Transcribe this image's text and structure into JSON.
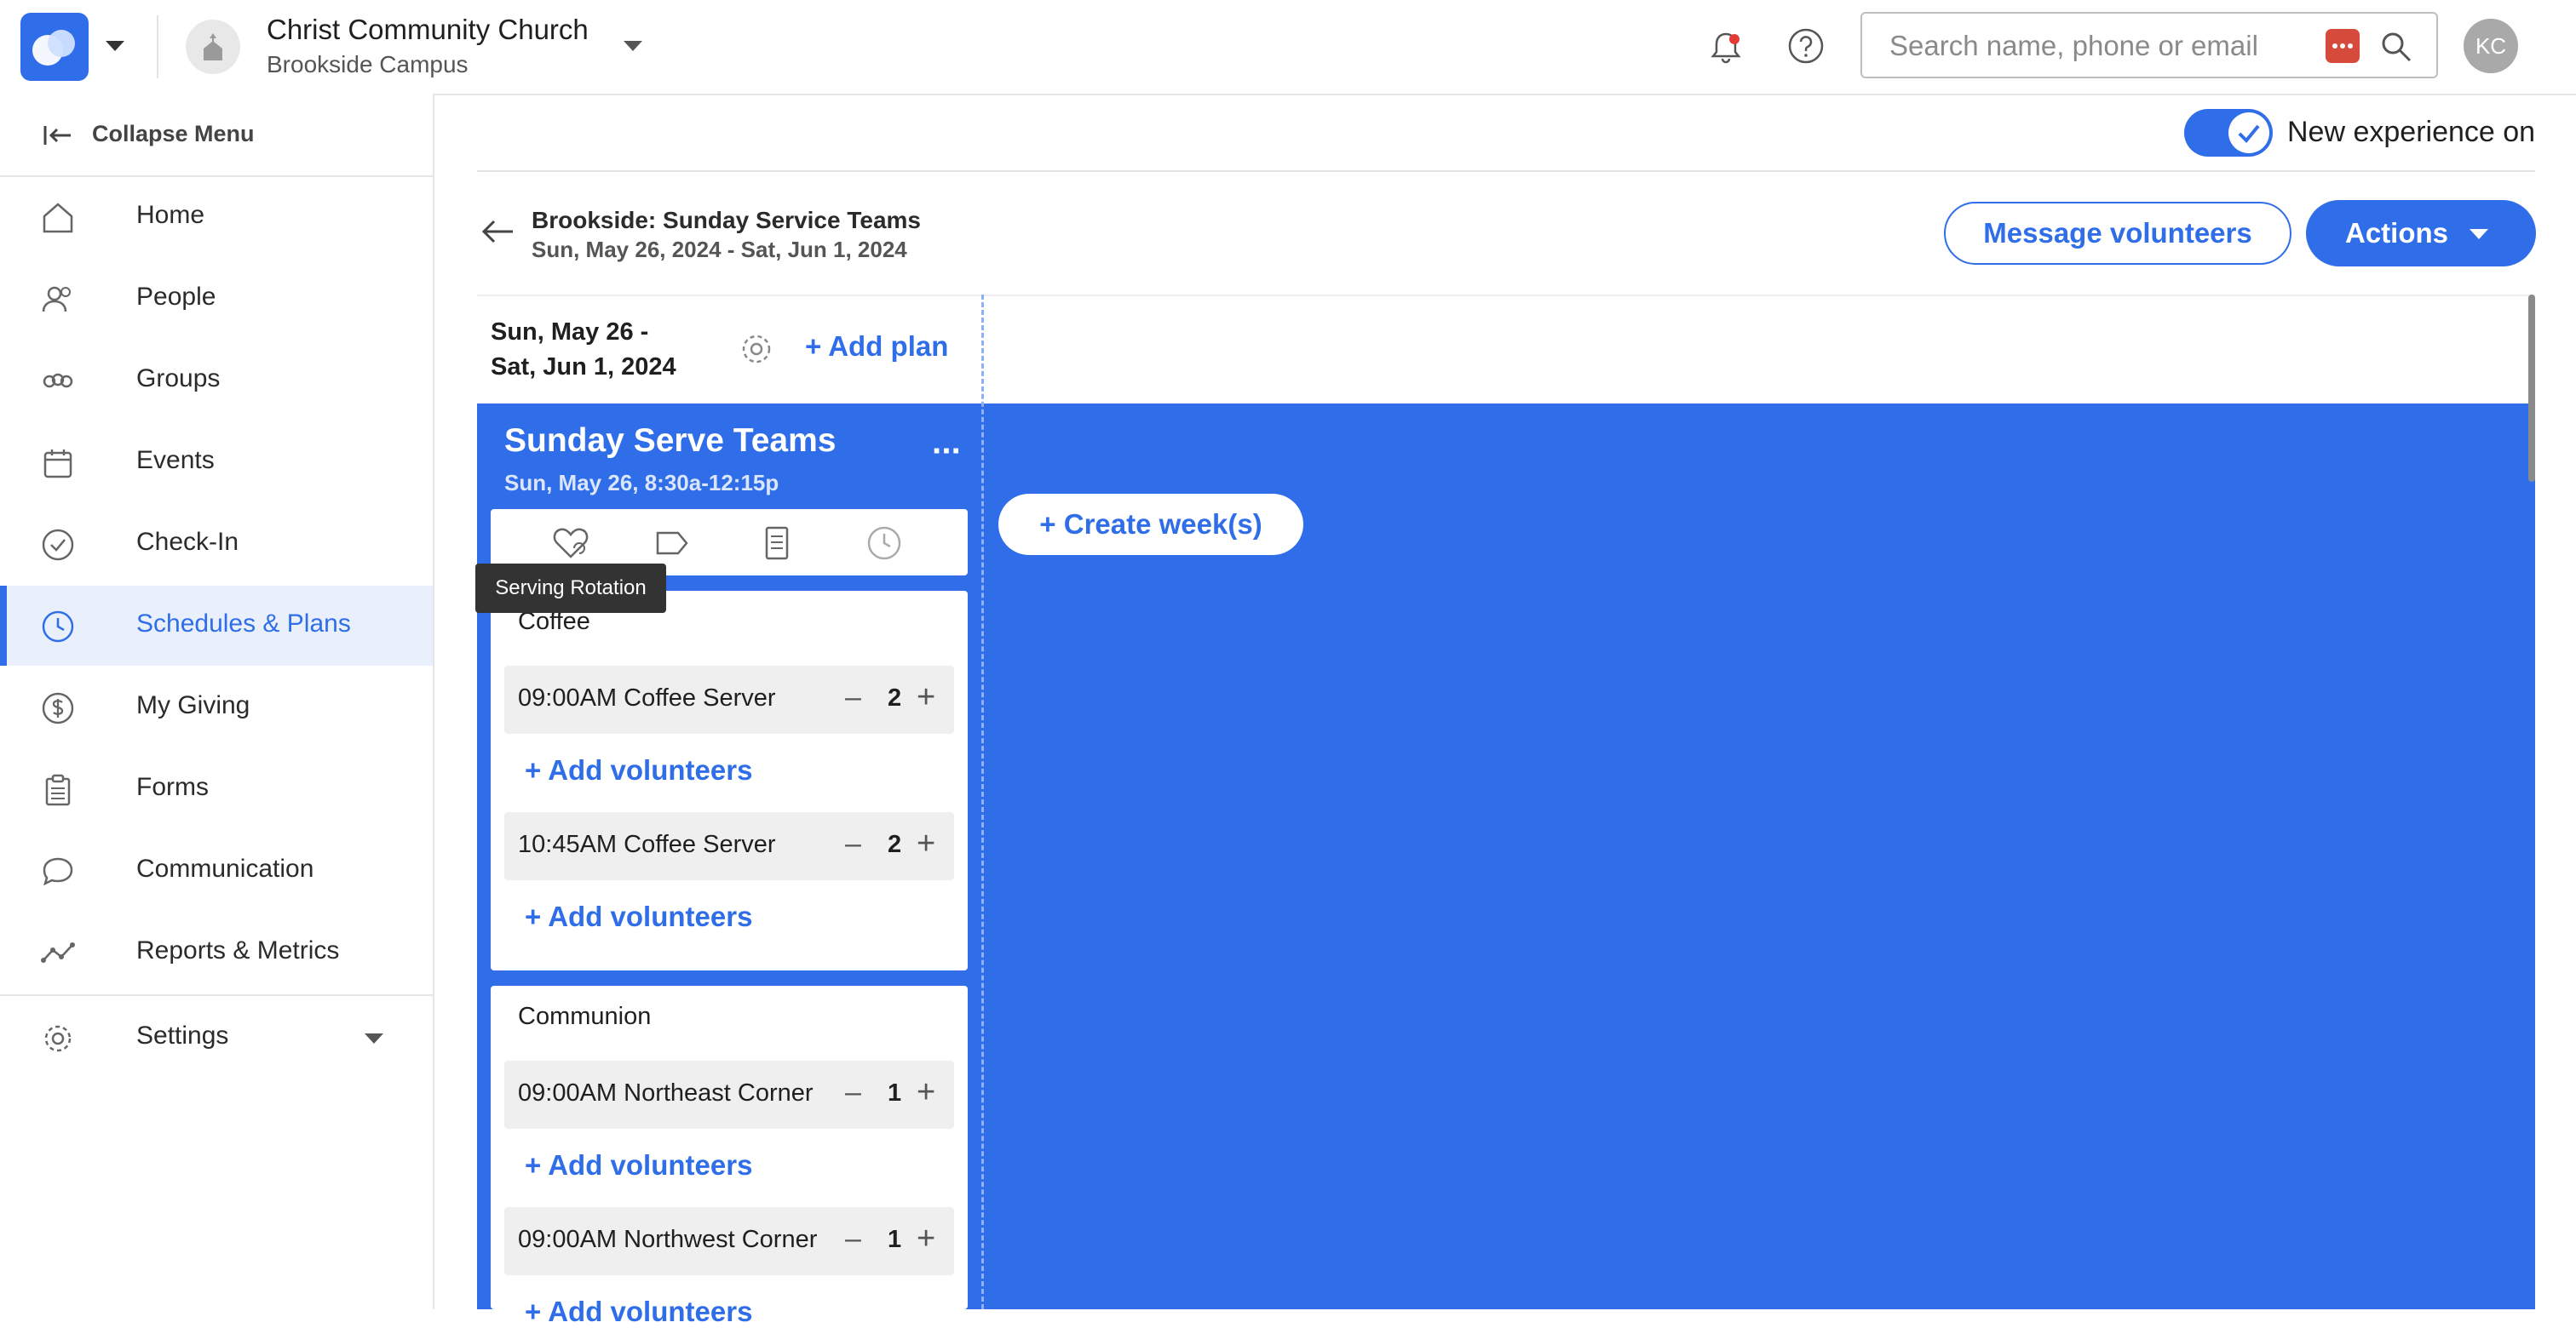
{
  "header": {
    "church_name": "Christ Community Church",
    "campus": "Brookside Campus",
    "search_placeholder": "Search name, phone or email",
    "avatar_initials": "KC",
    "accent_color": "#2f6ee8"
  },
  "sidebar": {
    "collapse_label": "Collapse Menu",
    "items": [
      {
        "label": "Home",
        "icon": "home-icon"
      },
      {
        "label": "People",
        "icon": "people-icon"
      },
      {
        "label": "Groups",
        "icon": "groups-icon"
      },
      {
        "label": "Events",
        "icon": "calendar-icon"
      },
      {
        "label": "Check-In",
        "icon": "check-circle-icon"
      },
      {
        "label": "Schedules & Plans",
        "icon": "clock-icon",
        "active": true
      },
      {
        "label": "My Giving",
        "icon": "dollar-icon"
      },
      {
        "label": "Forms",
        "icon": "clipboard-icon"
      },
      {
        "label": "Communication",
        "icon": "chat-icon"
      },
      {
        "label": "Reports & Metrics",
        "icon": "chart-line-icon"
      }
    ],
    "settings_label": "Settings"
  },
  "main": {
    "toggle_label": "New experience on",
    "plan_title": "Brookside: Sunday Service Teams",
    "plan_dates": "Sun, May 26, 2024 - Sat, Jun 1, 2024",
    "message_button": "Message volunteers",
    "actions_button": "Actions",
    "week_label": "Sun, May 26 - Sat, Jun 1, 2024",
    "add_plan": "+ Add plan",
    "create_week": "+ Create week(s)"
  },
  "column": {
    "title": "Sunday Serve Teams",
    "subtitle": "Sun, May 26, 8:30a-12:15p",
    "tooltip": "Serving Rotation",
    "teams": [
      {
        "name": "Coffee",
        "slots": [
          {
            "label": "09:00AM Coffee Server",
            "count": "2"
          },
          {
            "label": "10:45AM Coffee Server",
            "count": "2"
          }
        ]
      },
      {
        "name": "Communion",
        "slots": [
          {
            "label": "09:00AM Northeast Corner",
            "count": "1"
          },
          {
            "label": "09:00AM Northwest Corner",
            "count": "1"
          }
        ]
      }
    ],
    "add_volunteers": "+ Add volunteers"
  }
}
